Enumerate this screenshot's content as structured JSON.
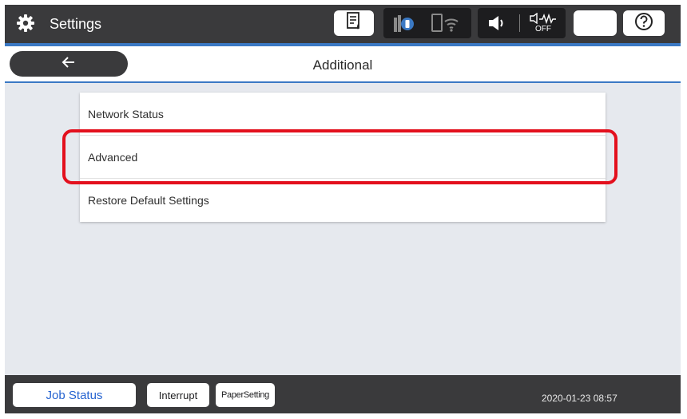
{
  "header": {
    "title": "Settings",
    "icons": {
      "settings": "gear-icon",
      "job_monitor": "document-ink-icon",
      "ink_supply": "ink-icon",
      "wifi_status": "wifi-icon",
      "speaker": "speaker-icon",
      "quiet_mode": "quiet-mode-icon",
      "sleep": "moon-icon",
      "help": "help-icon"
    },
    "quiet_mode_label": "OFF"
  },
  "title_bar": {
    "back_icon": "arrow-left-icon",
    "title": "Additional"
  },
  "menu": {
    "items": [
      {
        "label": "Network Status"
      },
      {
        "label": "Advanced"
      },
      {
        "label": "Restore Default Settings"
      }
    ],
    "highlighted_index": 1
  },
  "footer": {
    "job_status_label": "Job Status",
    "interrupt_label": "Interrupt",
    "paper_setting_label": "PaperSetting",
    "datetime": "2020-01-23 08:57"
  },
  "colors": {
    "bar_dark": "#3a3a3c",
    "accent_blue": "#3b79c4",
    "highlight_red": "#e3101d",
    "background": "#e6e9ee",
    "job_status_text": "#2563d0"
  }
}
